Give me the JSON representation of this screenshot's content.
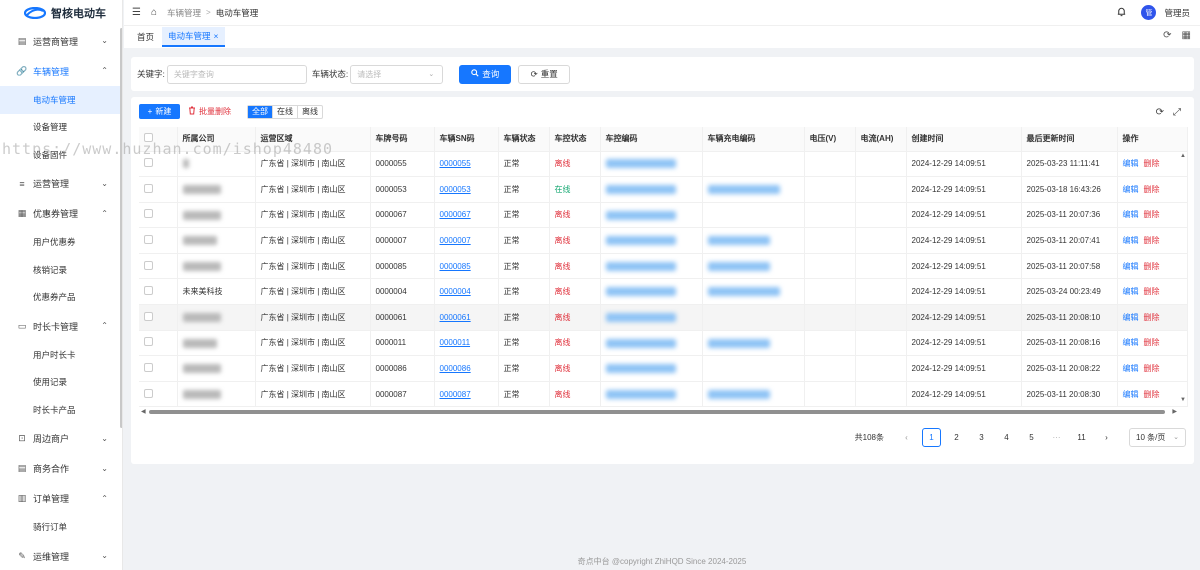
{
  "app": {
    "title": "智核电动车"
  },
  "sidebar": {
    "groups": [
      {
        "label": "运营商管理",
        "icon": "document-icon",
        "open": false
      },
      {
        "label": "车辆管理",
        "icon": "link-icon",
        "open": true,
        "items": [
          "电动车管理",
          "设备管理",
          "设备固件"
        ]
      },
      {
        "label": "运营管理",
        "icon": "list-icon",
        "open": false
      },
      {
        "label": "优惠券管理",
        "icon": "calendar-icon",
        "open": true,
        "items": [
          "用户优惠券",
          "核销记录",
          "优惠券产品"
        ]
      },
      {
        "label": "时长卡管理",
        "icon": "card-icon",
        "open": true,
        "items": [
          "用户时长卡",
          "使用记录",
          "时长卡产品"
        ]
      },
      {
        "label": "周边商户",
        "icon": "store-icon",
        "open": false
      },
      {
        "label": "商务合作",
        "icon": "document-icon",
        "open": false
      },
      {
        "label": "订单管理",
        "icon": "order-icon",
        "open": true,
        "items": [
          "骑行订单"
        ]
      },
      {
        "label": "运维管理",
        "icon": "tool-icon",
        "open": false
      }
    ]
  },
  "header": {
    "breadcrumb": [
      "车辆管理",
      "电动车管理"
    ],
    "user": "管理员",
    "avatar_text": "管"
  },
  "tabs": [
    {
      "label": "首页"
    },
    {
      "label": "电动车管理",
      "close": "×"
    }
  ],
  "search": {
    "keyword_label": "关键字:",
    "keyword_placeholder": "关键字查询",
    "status_label": "车辆状态:",
    "status_placeholder": "请选择",
    "query_button": "查询",
    "reset_button": "重置"
  },
  "toolbar": {
    "new_button": "新建",
    "batch_delete": "批量删除",
    "filters": [
      "全部",
      "在线",
      "离线"
    ],
    "active_filter": "全部"
  },
  "table": {
    "columns": [
      "所属公司",
      "运营区域",
      "车牌号码",
      "车辆SN码",
      "车辆状态",
      "车控状态",
      "车控编码",
      "车辆充电编码",
      "电压(V)",
      "电流(AH)",
      "创建时间",
      "最后更新时间",
      "操作"
    ],
    "rows": [
      {
        "company": "",
        "region": "广东省 | 深圳市 | 南山区",
        "plate": "0000055",
        "sn": "0000055",
        "status": "正常",
        "ctrl": "离线",
        "created": "2024-12-29 14:09:51",
        "updated": "2025-03-23 11:11:41"
      },
      {
        "company": "",
        "region": "广东省 | 深圳市 | 南山区",
        "plate": "0000053",
        "sn": "0000053",
        "status": "正常",
        "ctrl": "在线",
        "created": "2024-12-29 14:09:51",
        "updated": "2025-03-18 16:43:26"
      },
      {
        "company": "",
        "region": "广东省 | 深圳市 | 南山区",
        "plate": "0000067",
        "sn": "0000067",
        "status": "正常",
        "ctrl": "离线",
        "created": "2024-12-29 14:09:51",
        "updated": "2025-03-11 20:07:36"
      },
      {
        "company": "",
        "region": "广东省 | 深圳市 | 南山区",
        "plate": "0000007",
        "sn": "0000007",
        "status": "正常",
        "ctrl": "离线",
        "created": "2024-12-29 14:09:51",
        "updated": "2025-03-11 20:07:41"
      },
      {
        "company": "",
        "region": "广东省 | 深圳市 | 南山区",
        "plate": "0000085",
        "sn": "0000085",
        "status": "正常",
        "ctrl": "离线",
        "created": "2024-12-29 14:09:51",
        "updated": "2025-03-11 20:07:58"
      },
      {
        "company": "未来美科技",
        "region": "广东省 | 深圳市 | 南山区",
        "plate": "0000004",
        "sn": "0000004",
        "status": "正常",
        "ctrl": "离线",
        "created": "2024-12-29 14:09:51",
        "updated": "2025-03-24 00:23:49"
      },
      {
        "company": "",
        "region": "广东省 | 深圳市 | 南山区",
        "plate": "0000061",
        "sn": "0000061",
        "status": "正常",
        "ctrl": "离线",
        "created": "2024-12-29 14:09:51",
        "updated": "2025-03-11 20:08:10"
      },
      {
        "company": "",
        "region": "广东省 | 深圳市 | 南山区",
        "plate": "0000011",
        "sn": "0000011",
        "status": "正常",
        "ctrl": "离线",
        "created": "2024-12-29 14:09:51",
        "updated": "2025-03-11 20:08:16"
      },
      {
        "company": "",
        "region": "广东省 | 深圳市 | 南山区",
        "plate": "0000086",
        "sn": "0000086",
        "status": "正常",
        "ctrl": "离线",
        "created": "2024-12-29 14:09:51",
        "updated": "2025-03-11 20:08:22"
      },
      {
        "company": "",
        "region": "广东省 | 深圳市 | 南山区",
        "plate": "0000087",
        "sn": "0000087",
        "status": "正常",
        "ctrl": "离线",
        "created": "2024-12-29 14:09:51",
        "updated": "2025-03-11 20:08:30"
      }
    ],
    "edit_label": "编辑",
    "delete_label": "删除"
  },
  "pagination": {
    "total": "共108条",
    "pages": [
      "1",
      "2",
      "3",
      "4",
      "5"
    ],
    "more": "···",
    "last": "11",
    "current": "1",
    "page_size": "10 条/页"
  },
  "footer": "奇点中台 @copyright ZhiHQD Since 2024-2025",
  "watermark": "https://www.huzhan.com/ishop48480",
  "colors": {
    "primary": "#1677ff",
    "danger": "#e0313c",
    "online": "#19a974"
  }
}
